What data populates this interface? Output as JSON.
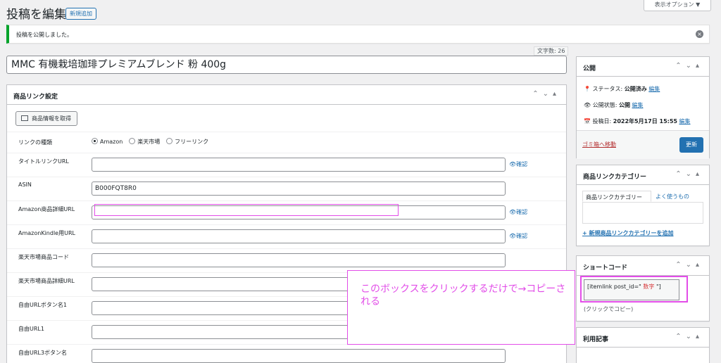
{
  "header": {
    "title": "投稿を編集",
    "add_new": "新規追加",
    "screen_options": "表示オプション ▼"
  },
  "notice": {
    "text": "投稿を公開しました。"
  },
  "editor": {
    "char_count": "文字数: 26",
    "post_title": "MMC 有機栽培珈琲プレミアムブレンド 粉 400g"
  },
  "product_box": {
    "title": "商品リンク設定",
    "fetch_button": "商品情報を取得",
    "confirm_label": "確認",
    "link_type": {
      "label": "リンクの種類",
      "options": [
        "Amazon",
        "楽天市場",
        "フリーリンク"
      ],
      "selected": "Amazon"
    },
    "fields": [
      {
        "label": "タイトルリンクURL",
        "value": ""
      },
      {
        "label": "ASIN",
        "value": "B000FQT8R0"
      },
      {
        "label": "Amazon商品詳細URL",
        "value": ""
      },
      {
        "label": "AmazonKindle用URL",
        "value": ""
      },
      {
        "label": "楽天市場商品コード",
        "value": ""
      },
      {
        "label": "楽天市場商品詳細URL",
        "value": ""
      },
      {
        "label": "自由URLボタン名1",
        "value": ""
      },
      {
        "label": "自由URL1",
        "value": ""
      },
      {
        "label": "自由URL3ボタン名",
        "value": ""
      }
    ]
  },
  "publish_box": {
    "title": "公開",
    "status_label": "ステータス: ",
    "status_value": "公開済み",
    "visibility_label": "公開状態: ",
    "visibility_value": "公開",
    "date_label": "投稿日: ",
    "date_value": "2022年5月17日 15:55",
    "edit_link": "編集",
    "trash_link": "ゴミ箱へ移動",
    "update_button": "更新"
  },
  "category_box": {
    "title": "商品リンクカテゴリー",
    "tab_all": "商品リンクカテゴリー",
    "tab_popular": "よく使うもの",
    "add_new": "+ 新規商品リンクカテゴリーを追加"
  },
  "shortcode_box": {
    "title": "ショートコード",
    "code_prefix": "[itemlink post_id=\"",
    "code_number": " 数字 ",
    "code_suffix": "\"]",
    "hint": "(クリックでコピー)"
  },
  "usage_box": {
    "title": "利用記事"
  },
  "annotation": {
    "text": "このボックスをクリックするだけで→コピーされる",
    "color": "#e24de8"
  }
}
